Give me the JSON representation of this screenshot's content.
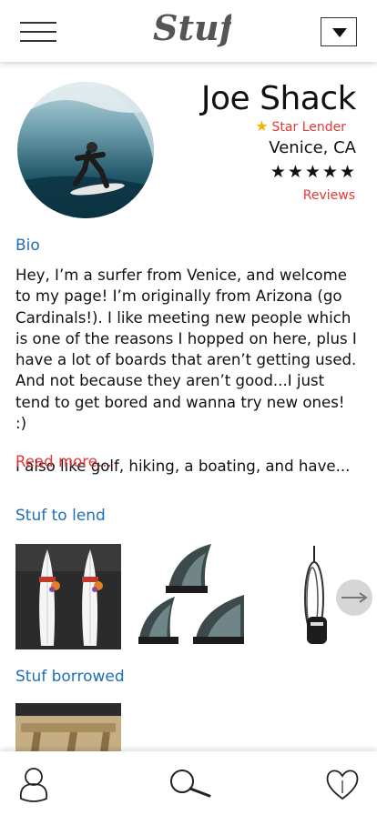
{
  "app": {
    "logo_text": "Stuf"
  },
  "profile": {
    "name": "Joe Shack",
    "badge": "Star Lender",
    "location": "Venice, CA",
    "rating_stars": "★★★★★",
    "rating": 5,
    "reviews_label": "Reviews"
  },
  "bio": {
    "title": "Bio",
    "paragraphs": [
      "Hey, I’m a surfer from Venice, and welcome to my page! I’m originally from Arizona (go Cardinals!). I like meeting new people which is one of the reasons I hopped on here, plus I have a lot of boards that aren’t getting used. And not because they aren’t good...I just tend to get bored and wanna try new ones! :)",
      "I also like golf, hiking, a boating, and have..."
    ],
    "read_more": "Read more..."
  },
  "lend": {
    "title": "Stuf to lend",
    "items": [
      "surfboards",
      "surf-fins",
      "surf-leash"
    ]
  },
  "borrowed": {
    "title": "Stuf borrowed",
    "items": [
      "wooden-sawhorses"
    ]
  },
  "bottom_nav": [
    "profile",
    "search",
    "favorites"
  ],
  "colors": {
    "accent_blue": "#1e6fb6",
    "accent_red": "#e53935",
    "star_gold": "#f4b400"
  }
}
